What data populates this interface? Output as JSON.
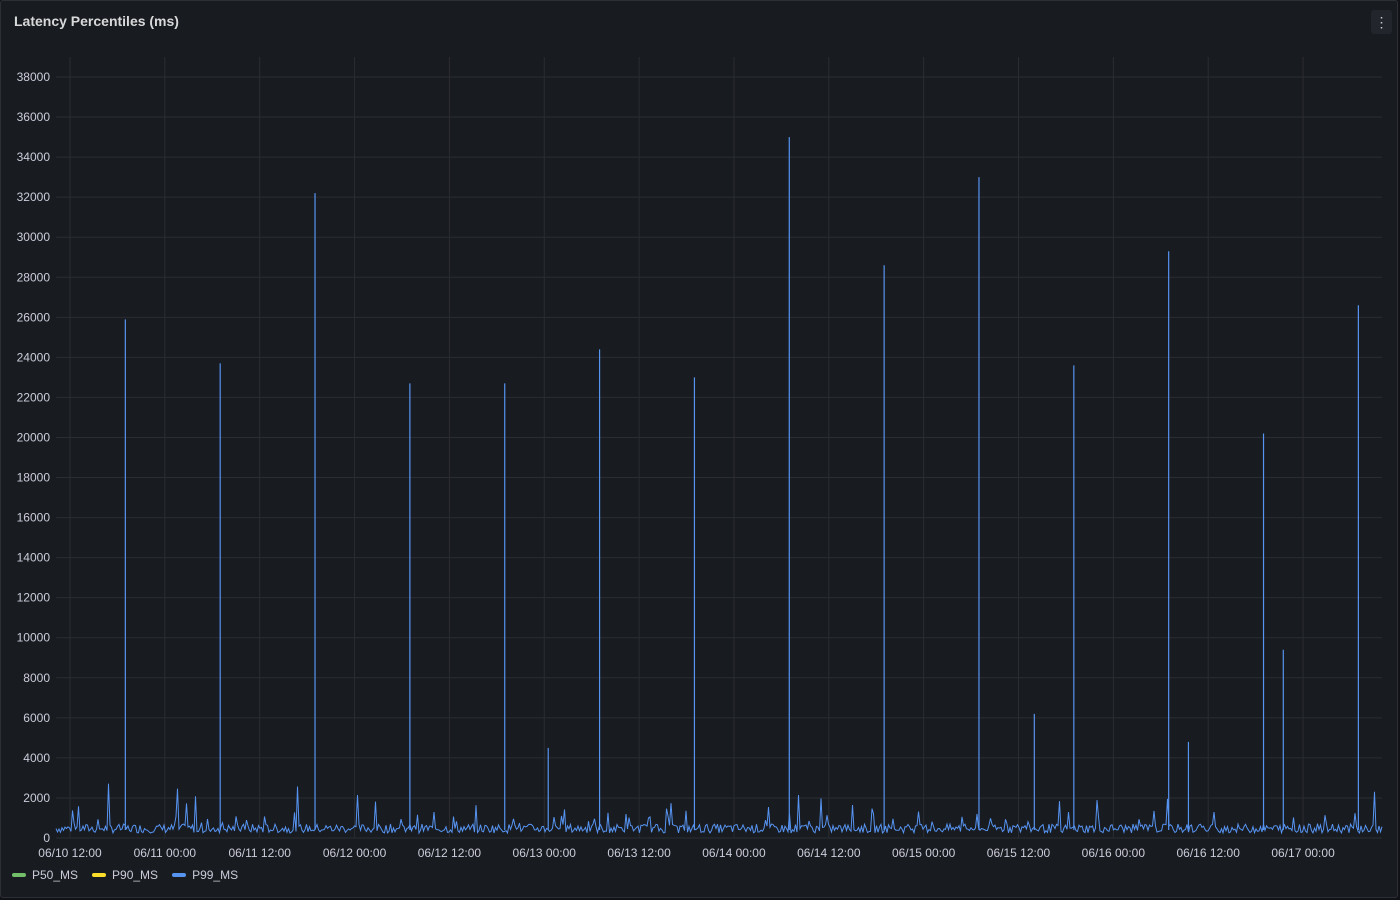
{
  "panel": {
    "title": "Latency Percentiles (ms)",
    "menu_icon": "more-vertical-icon"
  },
  "chart_data": {
    "type": "line",
    "title": "Latency Percentiles (ms)",
    "xlabel": "",
    "ylabel": "",
    "ylim": [
      0,
      38000
    ],
    "y_ticks": [
      0,
      2000,
      4000,
      6000,
      8000,
      10000,
      12000,
      14000,
      16000,
      18000,
      20000,
      22000,
      24000,
      26000,
      28000,
      30000,
      32000,
      34000,
      36000,
      38000
    ],
    "x_range": [
      "06/10 12:00",
      "06/17 08:00"
    ],
    "x_ticks": [
      "06/10 12:00",
      "06/11 00:00",
      "06/11 12:00",
      "06/12 00:00",
      "06/12 12:00",
      "06/13 00:00",
      "06/13 12:00",
      "06/14 00:00",
      "06/14 12:00",
      "06/15 00:00",
      "06/15 12:00",
      "06/16 00:00",
      "06/16 12:00",
      "06/17 00:00"
    ],
    "grid": true,
    "legend_position": "bottom-left",
    "series": [
      {
        "name": "P50_MS",
        "color": "#73bf69"
      },
      {
        "name": "P90_MS",
        "color": "#fade2a"
      },
      {
        "name": "P99_MS",
        "color": "#5794f2",
        "baseline_ms": 500,
        "spikes": [
          {
            "x": "06/10 19:00",
            "y": 25900
          },
          {
            "x": "06/11 07:00",
            "y": 23700
          },
          {
            "x": "06/11 19:00",
            "y": 32200
          },
          {
            "x": "06/12 07:00",
            "y": 22700
          },
          {
            "x": "06/12 19:00",
            "y": 22700
          },
          {
            "x": "06/13 00:30",
            "y": 4500
          },
          {
            "x": "06/13 07:00",
            "y": 24400
          },
          {
            "x": "06/13 19:00",
            "y": 23000
          },
          {
            "x": "06/14 07:00",
            "y": 35000
          },
          {
            "x": "06/14 19:00",
            "y": 28600
          },
          {
            "x": "06/15 07:00",
            "y": 33000
          },
          {
            "x": "06/15 14:00",
            "y": 6200
          },
          {
            "x": "06/15 19:00",
            "y": 23600
          },
          {
            "x": "06/16 07:00",
            "y": 29300
          },
          {
            "x": "06/16 09:30",
            "y": 4800
          },
          {
            "x": "06/16 19:00",
            "y": 20200
          },
          {
            "x": "06/16 21:30",
            "y": 9400
          },
          {
            "x": "06/17 07:00",
            "y": 26600
          }
        ]
      }
    ]
  }
}
